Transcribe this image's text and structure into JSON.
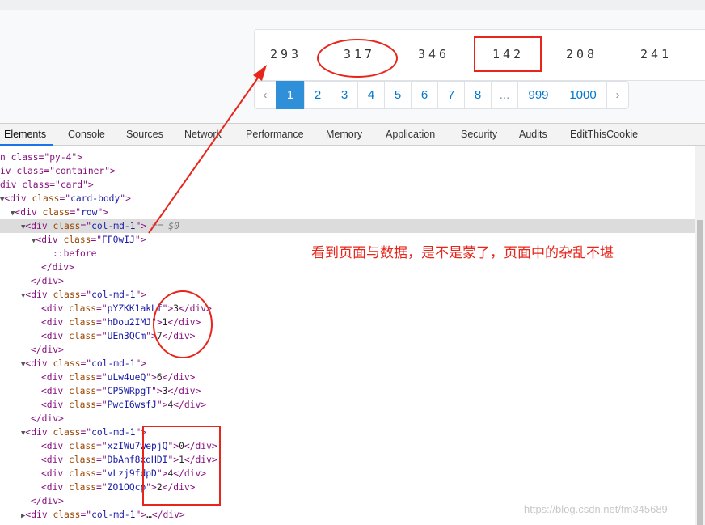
{
  "numbers": [
    "293",
    "317",
    "346",
    "142",
    "208",
    "241"
  ],
  "pagination": {
    "prev": "‹",
    "pages": [
      "1",
      "2",
      "3",
      "4",
      "5",
      "6",
      "7",
      "8",
      "...",
      "999",
      "1000"
    ],
    "active": "1",
    "next": "›"
  },
  "devtools": {
    "tabs": [
      "Elements",
      "Console",
      "Sources",
      "Network",
      "Performance",
      "Memory",
      "Application",
      "Security",
      "Audits",
      "EditThisCookie"
    ],
    "active_tab": "Elements"
  },
  "dom": {
    "line0": "n class=\"py-4\">",
    "line1": "iv class=\"container\">",
    "line2": "div class=\"card\">",
    "card_body": "card-body",
    "row": "row",
    "col": "col-md-1",
    "selected_suffix": " == $0",
    "ff_class": "FF0wIJ",
    "before": "::before",
    "group1": [
      {
        "cls": "pYZKK1akLf",
        "val": "3"
      },
      {
        "cls": "hDou2IMJ",
        "val": "1"
      },
      {
        "cls": "UEn3QCm",
        "val": "7"
      }
    ],
    "group2": [
      {
        "cls": "uLw4ueQ",
        "val": "6"
      },
      {
        "cls": "CP5WRpgT",
        "val": "3"
      },
      {
        "cls": "PwcI6wsfJ",
        "val": "4"
      }
    ],
    "group3": [
      {
        "cls": "xzIWu7wepjQ",
        "val": "0"
      },
      {
        "cls": "DbAnf8xdHDI",
        "val": "1"
      },
      {
        "cls": "vLzj9fdpD",
        "val": "4"
      },
      {
        "cls": "ZO1OQcp",
        "val": "2"
      }
    ],
    "collapsed_ellipsis": "…"
  },
  "annotation": {
    "note": "看到页面与数据，是不是蒙了，页面中的杂乱不堪",
    "color": "#e8251b"
  },
  "watermark": "https://blog.csdn.net/fm345689"
}
